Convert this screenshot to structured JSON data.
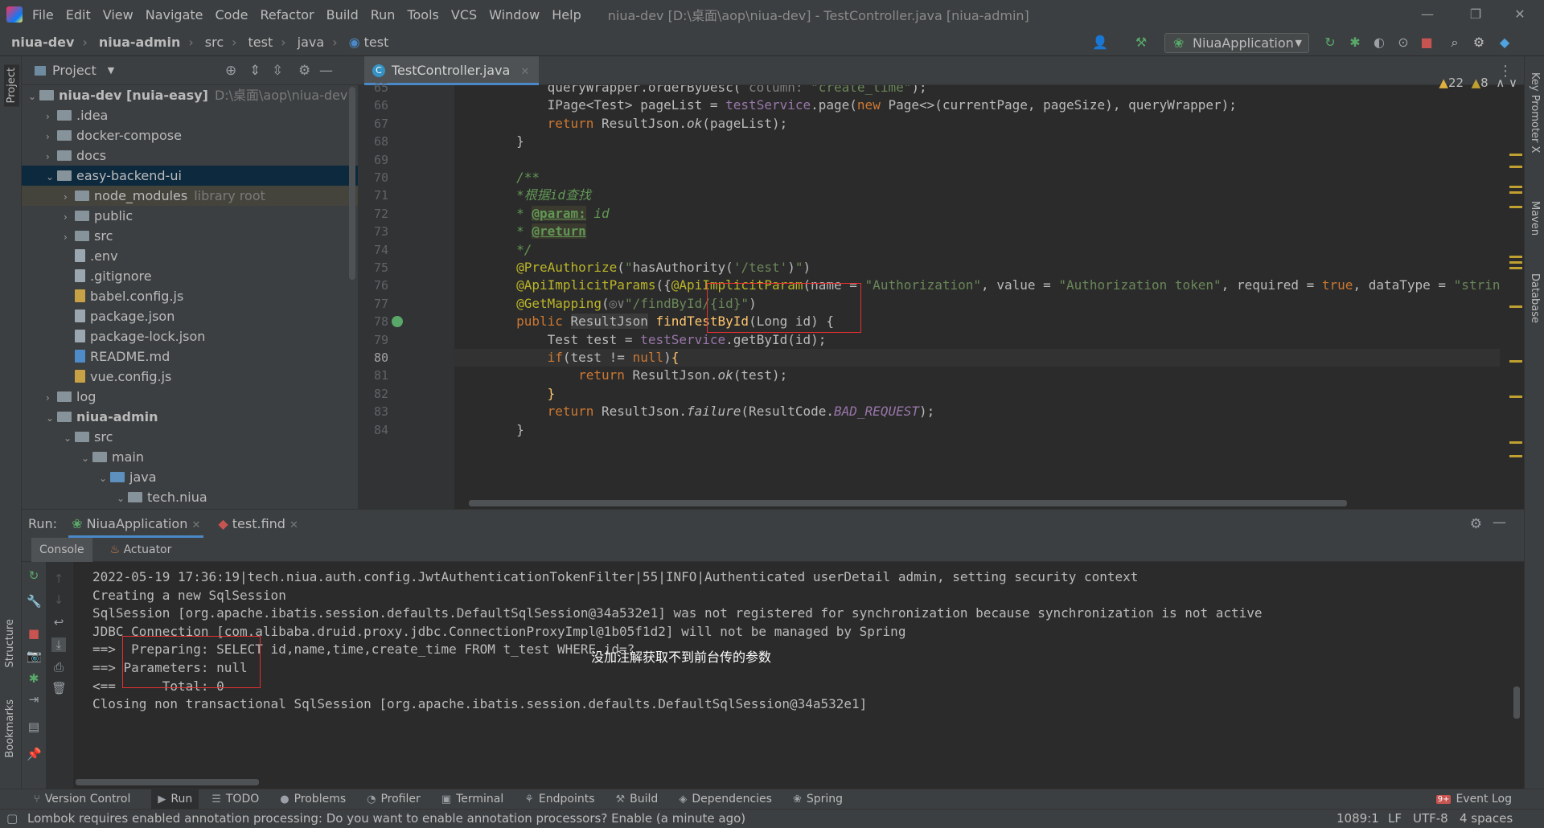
{
  "menu": {
    "items": [
      "File",
      "Edit",
      "View",
      "Navigate",
      "Code",
      "Refactor",
      "Build",
      "Run",
      "Tools",
      "VCS",
      "Window",
      "Help"
    ],
    "window_title": "niua-dev [D:\\桌面\\aop\\niua-dev] - TestController.java [niua-admin]"
  },
  "breadcrumb": {
    "items": [
      "niua-dev",
      "niua-admin",
      "src",
      "test",
      "java",
      "test"
    ]
  },
  "toolbar": {
    "run_config": "NiuaApplication"
  },
  "sidebar": {
    "project_label": "Project",
    "structure_label": "Structure",
    "bookmarks_label": "Bookmarks"
  },
  "right_sidebar": {
    "key_promoter": "Key Promoter X",
    "maven": "Maven",
    "database": "Database"
  },
  "project": {
    "header": "Project",
    "tree": [
      {
        "name": "niua-dev [nuia-easy]",
        "extra": "D:\\桌面\\aop\\niua-dev",
        "depth": 0,
        "type": "folder",
        "expanded": true,
        "bold": true
      },
      {
        "name": ".idea",
        "depth": 1,
        "type": "folder",
        "expanded": false
      },
      {
        "name": "docker-compose",
        "depth": 1,
        "type": "folder",
        "expanded": false
      },
      {
        "name": "docs",
        "depth": 1,
        "type": "folder",
        "expanded": false
      },
      {
        "name": "easy-backend-ui",
        "depth": 1,
        "type": "folder",
        "expanded": true,
        "selected": true
      },
      {
        "name": "node_modules",
        "extra": "library root",
        "depth": 2,
        "type": "folder",
        "expanded": false,
        "lib": true
      },
      {
        "name": "public",
        "depth": 2,
        "type": "folder",
        "expanded": false
      },
      {
        "name": "src",
        "depth": 2,
        "type": "folder",
        "expanded": false
      },
      {
        "name": ".env",
        "depth": 2,
        "type": "file"
      },
      {
        "name": ".gitignore",
        "depth": 2,
        "type": "file"
      },
      {
        "name": "babel.config.js",
        "depth": 2,
        "type": "js"
      },
      {
        "name": "package.json",
        "depth": 2,
        "type": "file"
      },
      {
        "name": "package-lock.json",
        "depth": 2,
        "type": "file"
      },
      {
        "name": "README.md",
        "depth": 2,
        "type": "md"
      },
      {
        "name": "vue.config.js",
        "depth": 2,
        "type": "js"
      },
      {
        "name": "log",
        "depth": 1,
        "type": "folder",
        "expanded": false
      },
      {
        "name": "niua-admin",
        "depth": 1,
        "type": "folder",
        "expanded": true,
        "bold": true
      },
      {
        "name": "src",
        "depth": 2,
        "type": "folder",
        "expanded": true
      },
      {
        "name": "main",
        "depth": 3,
        "type": "folder",
        "expanded": true
      },
      {
        "name": "java",
        "depth": 4,
        "type": "folder-blue",
        "expanded": true
      },
      {
        "name": "tech.niua",
        "depth": 5,
        "type": "package",
        "expanded": true
      }
    ]
  },
  "editor": {
    "tab": "TestController.java",
    "warnings": "22",
    "weak_warnings": "8",
    "lines": [
      {
        "n": "65",
        "html": "            queryWrapper.orderByDesc( <span class='gry'>column:</span> <span class='str'>\"create_time\"</span>);"
      },
      {
        "n": "66",
        "html": "            IPage&lt;Test&gt; pageList = <span class='fld'>testService</span>.page(<span class='kw'>new</span> Page&lt;&gt;(currentPage, pageSize), queryWrapper);"
      },
      {
        "n": "67",
        "html": "            <span class='kw'>return</span> ResultJson.<span class='itl'>ok</span>(pageList);"
      },
      {
        "n": "68",
        "html": "        }"
      },
      {
        "n": "69",
        "html": ""
      },
      {
        "n": "70",
        "html": "        <span class='cm'>/**</span>"
      },
      {
        "n": "71",
        "html": "        <span class='cm'>*根据id查找</span>"
      },
      {
        "n": "72",
        "html": "        <span class='cm'>* </span><span class='tag'>@param:</span><span class='cm'> id</span>"
      },
      {
        "n": "73",
        "html": "        <span class='cm'>* </span><span class='tag'>@return</span>"
      },
      {
        "n": "74",
        "html": "        <span class='cm'>*/</span>"
      },
      {
        "n": "75",
        "html": "        <span class='ann'>@PreAuthorize</span>(<span class='str'>\"</span>hasAuthority(<span class='str'>'/test'</span>)<span class='str'>\"</span>)"
      },
      {
        "n": "76",
        "html": "        <span class='ann'>@ApiImplicitParams</span>({<span class='ann'>@ApiImplicitParam</span>(name = <span class='str'>\"Authorization\"</span>, value = <span class='str'>\"Authorization token\"</span>, required = <span class='kw'>true</span>, dataType = <span class='str'>\"strin</span>"
      },
      {
        "n": "77",
        "html": "        <span class='ann'>@GetMapping</span>(<span class='gry'>◎∨</span><span class='str'>\"/findById/{id}\"</span>)"
      },
      {
        "n": "78",
        "html": "        <span class='kw'>public</span> <span style='background:#3b3b3b'>ResultJson</span> <span class='fn'>findTestById</span>(Long id) {"
      },
      {
        "n": "79",
        "html": "            Test test = <span class='fld'>testService</span>.getById(id);"
      },
      {
        "n": "80",
        "html": "            <span class='kw'>if</span>(test != <span class='kw'>null</span>)<span class='fn'>{</span>",
        "cur": true
      },
      {
        "n": "81",
        "html": "                <span class='kw'>return</span> ResultJson.<span class='itl'>ok</span>(test);"
      },
      {
        "n": "82",
        "html": "            <span class='fn'>}</span>"
      },
      {
        "n": "83",
        "html": "            <span class='kw'>return</span> ResultJson.<span class='itl'>failure</span>(ResultCode.<span class='fld itl'>BAD_REQUEST</span>);"
      },
      {
        "n": "84",
        "html": "        }"
      }
    ]
  },
  "run": {
    "label": "Run:",
    "tabs": [
      "NiuaApplication",
      "test.find"
    ],
    "subtabs": [
      "Console",
      "Actuator"
    ],
    "console": [
      "2022-05-19 17:36:19|tech.niua.auth.config.JwtAuthenticationTokenFilter|55|INFO|Authenticated userDetail admin, setting security context",
      "Creating a new SqlSession",
      "SqlSession [org.apache.ibatis.session.defaults.DefaultSqlSession@34a532e1] was not registered for synchronization because synchronization is not active",
      "JDBC Connection [com.alibaba.druid.proxy.jdbc.ConnectionProxyImpl@1b05f1d2] will not be managed by Spring",
      "==>  Preparing: SELECT id,name,time,create_time FROM t_test WHERE id=?",
      "==> Parameters: null",
      "<==      Total: 0",
      "Closing non transactional SqlSession [org.apache.ibatis.session.defaults.DefaultSqlSession@34a532e1]"
    ],
    "annotation_note": "没加注解获取不到前台传的参数"
  },
  "toolwindows": [
    "Version Control",
    "Run",
    "TODO",
    "Problems",
    "Profiler",
    "Terminal",
    "Endpoints",
    "Build",
    "Dependencies",
    "Spring"
  ],
  "event_log": {
    "label": "Event Log",
    "badge": "9+"
  },
  "status": {
    "message": "Lombok requires enabled annotation processing: Do you want to enable annotation processors? Enable (a minute ago)",
    "position": "1089:1",
    "line_sep": "LF",
    "encoding": "UTF-8",
    "indent": "4 spaces"
  },
  "colors": {
    "accent": "#4a88c7",
    "highlight_box": "#e53030",
    "keyword": "#cc7832",
    "string": "#6a8759",
    "annotation": "#bbb529"
  }
}
